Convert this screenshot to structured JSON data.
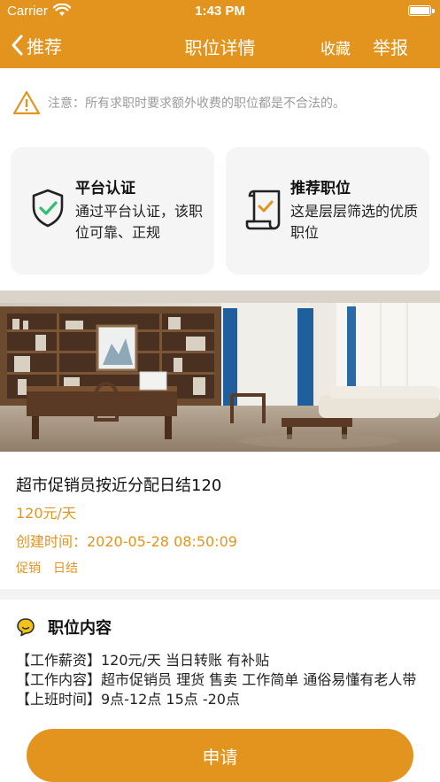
{
  "status_bar": {
    "carrier": "Carrier",
    "time": "1:43 PM"
  },
  "nav": {
    "back_label": "推荐",
    "title": "职位详情",
    "favorite_label": "收藏",
    "report_label": "举报"
  },
  "notice": {
    "text": "注意：所有求职时要求额外收费的职位都是不合法的。"
  },
  "cards": [
    {
      "title": "平台认证",
      "desc": "通过平台认证，该职位可靠、正规",
      "icon": "shield-check-icon"
    },
    {
      "title": "推荐职位",
      "desc": "这是层层筛选的优质职位",
      "icon": "scroll-check-icon"
    }
  ],
  "job": {
    "title": "超市促销员按近分配日结120",
    "salary": "120元/天",
    "created": "创建时间：2020-05-28 08:50:09",
    "tags": [
      "促销",
      "日结"
    ]
  },
  "section": {
    "title": "职位内容",
    "lines": [
      "【工作薪资】120元/天  当日转账  有补贴",
      "【工作内容】超市促销员 理货 售卖 工作简单 通俗易懂有老人带",
      "【上班时间】9点-12点  15点 -20点"
    ]
  },
  "apply_button": {
    "label": "申请"
  },
  "colors": {
    "accent": "#e2941f",
    "card_bg": "#f5f5f5",
    "icon_green": "#2fbf71"
  }
}
